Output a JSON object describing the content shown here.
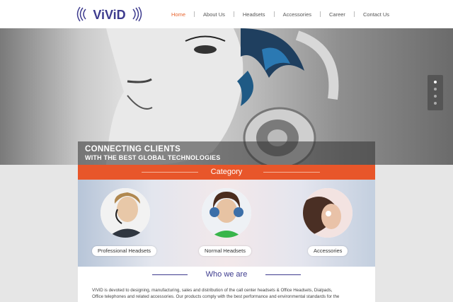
{
  "brand": {
    "logo_text": "ViViD"
  },
  "nav": {
    "items": [
      "Home",
      "About Us",
      "Headsets",
      "Accessories",
      "Career",
      "Contact Us"
    ],
    "active": "Home"
  },
  "hero": {
    "line1": "CONNECTING CLIENTS",
    "line2": "WITH THE BEST GLOBAL TECHNOLOGIES",
    "slides": 4,
    "active_slide": 1
  },
  "category": {
    "title": "Category",
    "items": [
      "Professional Headsets",
      "Normal Headsets",
      "Accessories"
    ]
  },
  "about": {
    "title": "Who we are",
    "body_line1": "VIViD is devoted to designing, manufacturing, sales and distribution of the call center headsets & Office Headsets, Dialpads,",
    "body_line2": "Office telephones and related accessories. Our products comply with the best performance and environmental standards for the"
  },
  "colors": {
    "accent": "#e8562a",
    "brand": "#3d3b8e",
    "active_nav": "#e8642c"
  }
}
